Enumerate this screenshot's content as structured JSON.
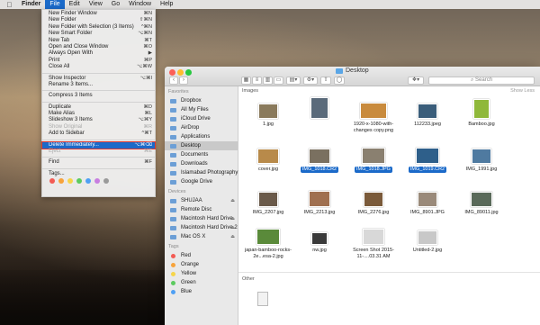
{
  "menubar": {
    "apple": "",
    "items": [
      {
        "label": "Finder",
        "bold": true
      },
      {
        "label": "File",
        "active": true
      },
      {
        "label": "Edit"
      },
      {
        "label": "View"
      },
      {
        "label": "Go"
      },
      {
        "label": "Window"
      },
      {
        "label": "Help"
      }
    ]
  },
  "file_menu": {
    "items": [
      {
        "label": "New Finder Window",
        "shortcut": "⌘N"
      },
      {
        "label": "New Folder",
        "shortcut": "⇧⌘N"
      },
      {
        "label": "New Folder with Selection (3 Items)",
        "shortcut": "^⌘N"
      },
      {
        "label": "New Smart Folder",
        "shortcut": "⌥⌘N"
      },
      {
        "label": "New Tab",
        "shortcut": "⌘T"
      },
      {
        "label": "Open and Close Window",
        "shortcut": "⌘O"
      },
      {
        "label": "Always Open With",
        "shortcut": "▶"
      },
      {
        "label": "Print",
        "shortcut": "⌘P"
      },
      {
        "label": "Close All",
        "shortcut": "⌥⌘W"
      },
      {
        "sep": true
      },
      {
        "label": "Show Inspector",
        "shortcut": "⌥⌘I"
      },
      {
        "label": "Rename 3 Items..."
      },
      {
        "sep": true
      },
      {
        "label": "Compress 3 Items"
      },
      {
        "sep": true
      },
      {
        "label": "Duplicate",
        "shortcut": "⌘D"
      },
      {
        "label": "Make Alias",
        "shortcut": "⌘L"
      },
      {
        "label": "Slideshow 3 Items",
        "shortcut": "⌥⌘Y"
      },
      {
        "label": "Show Original",
        "shortcut": "⌘R",
        "disabled": true
      },
      {
        "label": "Add to Sidebar",
        "shortcut": "^⌘T"
      },
      {
        "sep": true
      },
      {
        "label": "Delete Immediately...",
        "shortcut": "⌥⌘⌫",
        "highlight": true
      },
      {
        "label": "Eject",
        "shortcut": "⌘E",
        "disabled": true
      },
      {
        "sep": true
      },
      {
        "label": "Find",
        "shortcut": "⌘F"
      },
      {
        "sep": true
      },
      {
        "label": "Tags..."
      }
    ],
    "tag_colors": [
      "#f35b54",
      "#f7a33b",
      "#f6d54a",
      "#5ccb5f",
      "#4fa0f4",
      "#c87ee0",
      "#9a9a9a"
    ]
  },
  "finder": {
    "title": "Desktop",
    "search_placeholder": "Search",
    "sidebar": {
      "sections": [
        {
          "header": "Favorites",
          "items": [
            {
              "label": "Dropbox"
            },
            {
              "label": "All My Files"
            },
            {
              "label": "iCloud Drive"
            },
            {
              "label": "AirDrop"
            },
            {
              "label": "Applications"
            },
            {
              "label": "Desktop",
              "selected": true
            },
            {
              "label": "Documents"
            },
            {
              "label": "Downloads"
            },
            {
              "label": "Islamabad Photography"
            },
            {
              "label": "Google Drive"
            }
          ]
        },
        {
          "header": "Devices",
          "items": [
            {
              "label": "SHUJAA",
              "eject": "⏏"
            },
            {
              "label": "Remote Disc"
            },
            {
              "label": "Macintosh Hard Drive",
              "eject": "⏏"
            },
            {
              "label": "Macintosh Hard Drive 2",
              "eject": "⏏"
            },
            {
              "label": "Mac OS X",
              "eject": "⏏"
            }
          ]
        },
        {
          "header": "Tags",
          "items": [
            {
              "label": "Red",
              "color": "#f35b54"
            },
            {
              "label": "Orange",
              "color": "#f7a33b"
            },
            {
              "label": "Yellow",
              "color": "#f6d54a"
            },
            {
              "label": "Green",
              "color": "#5ccb5f"
            },
            {
              "label": "Blue",
              "color": "#4fa0f4"
            }
          ]
        }
      ]
    },
    "content": {
      "images_header": "Images",
      "show_less": "Show Less",
      "other_header": "Other",
      "files": [
        {
          "name": "1.jpg",
          "color": "#8a7a5c"
        },
        {
          "name": "",
          "color": "#5a6a7a"
        },
        {
          "name": "1920-x-1080-with-changes copy.png",
          "color": "#c98b3d"
        },
        {
          "name": "112233.jpeg",
          "color": "#3a5d7a"
        },
        {
          "name": "Bamboo.jpg",
          "color": "#8fb83a"
        },
        {
          "name": "cover.jpg",
          "color": "#b88a4a"
        },
        {
          "name": "IMG_1018.CR2",
          "color": "#7a7060",
          "selected": true
        },
        {
          "name": "IMG_1018.JPG",
          "color": "#8a8070",
          "selected": true
        },
        {
          "name": "IMG_1019.CR2",
          "color": "#2e5f8a",
          "selected": true
        },
        {
          "name": "IMG_1991.jpg",
          "color": "#4f7aa0"
        },
        {
          "name": "IMG_2207.jpg",
          "color": "#6a5a4a"
        },
        {
          "name": "IMG_2213.jpg",
          "color": "#a07050"
        },
        {
          "name": "IMG_2276.jpg",
          "color": "#7a5a3a"
        },
        {
          "name": "IMG_8901.JPG",
          "color": "#9a8a7a"
        },
        {
          "name": "IMG_89011.jpg",
          "color": "#5a6a5a"
        },
        {
          "name": "japan-bamboo-rocks-2e...esa-2.jpg",
          "color": "#5a8a3a"
        },
        {
          "name": "nw.jpg",
          "color": "#3a3a3a"
        },
        {
          "name": "Screen Shot 2015-11-....03.31 AM",
          "color": "#d8d8d8"
        },
        {
          "name": "Untitled-2.jpg",
          "color": "#c8c8c8"
        }
      ]
    }
  }
}
